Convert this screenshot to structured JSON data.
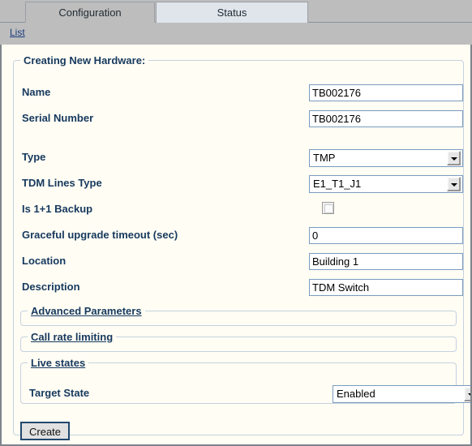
{
  "tabs": [
    {
      "label": "Configuration",
      "active": true
    },
    {
      "label": "Status",
      "active": false
    }
  ],
  "toolbar": {
    "list_link": "List"
  },
  "form": {
    "legend": "Creating New Hardware:",
    "fields": [
      {
        "label": "Name",
        "value": "TB002176",
        "control": "text"
      },
      {
        "label": "Serial Number",
        "value": "TB002176",
        "control": "text"
      },
      {
        "label": "Type",
        "value": "TMP",
        "control": "select"
      },
      {
        "label": "TDM Lines Type",
        "value": "E1_T1_J1",
        "control": "select"
      },
      {
        "label": "Is 1+1 Backup",
        "value": "",
        "control": "checkbox",
        "checked": false
      },
      {
        "label": "Graceful upgrade timeout (sec)",
        "value": "0",
        "control": "text"
      },
      {
        "label": "Location",
        "value": "Building 1",
        "control": "text"
      },
      {
        "label": "Description",
        "value": "TDM Switch",
        "control": "text"
      }
    ]
  },
  "sections": {
    "advanced_parameters": "Advanced Parameters",
    "call_rate_limiting": "Call rate limiting",
    "live_states": "Live states",
    "target_state_label": "Target State",
    "target_state_value": "Enabled"
  },
  "actions": {
    "create_label": "Create"
  },
  "colors": {
    "page_bg": "#fffdf4",
    "chrome_gray": "#bdbdbd",
    "label_navy": "#16395e",
    "field_border": "#7a9cbf",
    "fieldset_border": "#c6d2de",
    "inactive_tab": "#dfe5ea",
    "link_blue": "#1b3a7c",
    "button_focus_border": "#22486d"
  }
}
